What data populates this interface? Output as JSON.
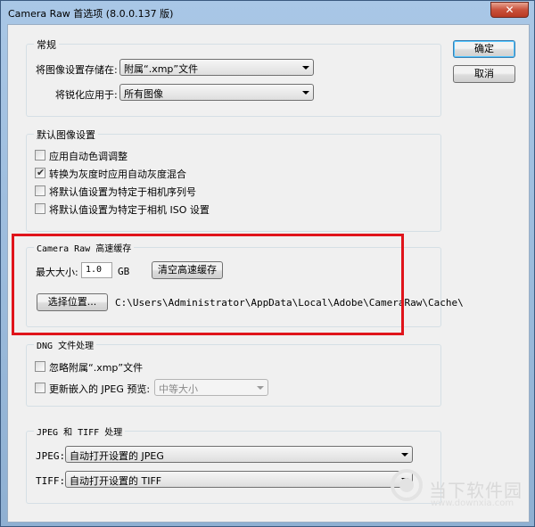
{
  "window": {
    "title": "Camera Raw 首选项 (8.0.0.137 版)",
    "close_label": "✕"
  },
  "buttons": {
    "ok": "确定",
    "cancel": "取消"
  },
  "general": {
    "label": "常规",
    "save_settings_label": "将图像设置存储在:",
    "save_settings_value": "附属“.xmp”文件",
    "apply_sharpening_label": "将锐化应用于:",
    "apply_sharpening_value": "所有图像"
  },
  "default_settings": {
    "label": "默认图像设置",
    "options": [
      {
        "label": "应用自动色调调整",
        "checked": false
      },
      {
        "label": "转换为灰度时应用自动灰度混合",
        "checked": true
      },
      {
        "label": "将默认值设置为特定于相机序列号",
        "checked": false
      },
      {
        "label": "将默认值设置为特定于相机 ISO 设置",
        "checked": false
      }
    ]
  },
  "cache": {
    "label": "Camera Raw 高速缓存",
    "max_size_label": "最大大小:",
    "max_size_value": "1.0",
    "unit": "GB",
    "purge_button": "清空高速缓存",
    "select_location_button": "选择位置...",
    "path": "C:\\Users\\Administrator\\AppData\\Local\\Adobe\\CameraRaw\\Cache\\",
    "highlight_color": "#e0141b"
  },
  "dng": {
    "label": "DNG 文件处理",
    "ignore_sidecar_label": "忽略附属“.xmp”文件",
    "update_preview_label": "更新嵌入的 JPEG 预览:",
    "preview_size_value": "中等大小"
  },
  "jpeg_tiff": {
    "label": "JPEG 和 TIFF 处理",
    "jpeg_label": "JPEG:",
    "jpeg_value": "自动打开设置的 JPEG",
    "tiff_label": "TIFF:",
    "tiff_value": "自动打开设置的 TIFF"
  },
  "watermark": {
    "text": "当下软件园",
    "url": "www.downxia.com"
  }
}
